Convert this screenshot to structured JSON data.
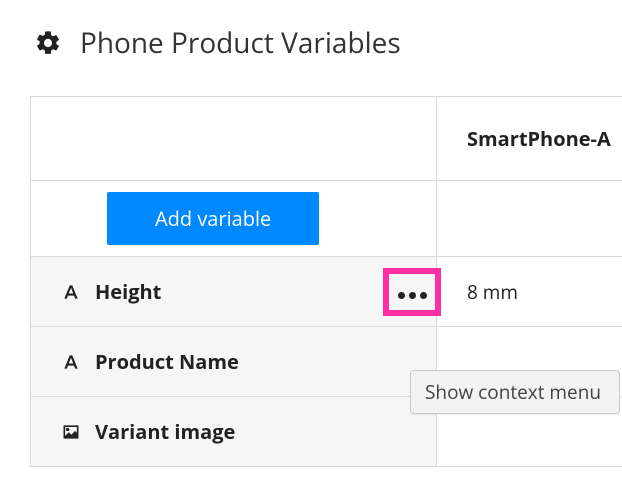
{
  "header": {
    "title": "Phone Product Variables"
  },
  "table": {
    "column_header": "SmartPhone-A",
    "add_button_label": "Add variable",
    "rows": [
      {
        "name": "Height",
        "value": "8 mm",
        "kind": "text",
        "show_more": true
      },
      {
        "name": "Product Name",
        "value": "",
        "kind": "text",
        "show_more": false
      },
      {
        "name": "Variant image",
        "value": "",
        "kind": "image",
        "show_more": false
      }
    ]
  },
  "tooltip": "Show context menu"
}
